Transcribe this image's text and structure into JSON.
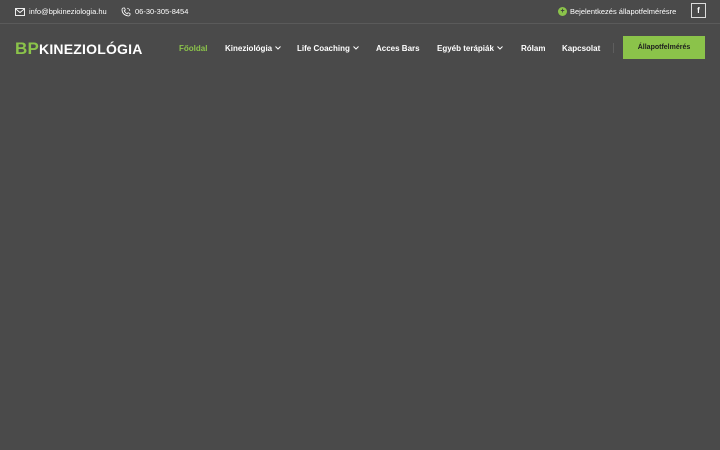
{
  "topbar": {
    "email": "info@bpkineziologia.hu",
    "phone": "06-30-305-8454",
    "booking": "Bejelentkezés állapotfelmérésre",
    "facebook": "f"
  },
  "logo": {
    "prefix": "BP",
    "name": "KINEZIOLÓGIA"
  },
  "nav": {
    "home": "Főoldal",
    "kineziologia": "Kineziológia",
    "life_coaching": "Life Coaching",
    "acces_bars": "Acces Bars",
    "egyeb": "Egyéb terápiák",
    "rolam": "Rólam",
    "kapcsolat": "Kapcsolat"
  },
  "cta": {
    "label": "Állapotfelmérés"
  },
  "colors": {
    "accent": "#8bc34a",
    "background": "#4a4a4a"
  },
  "icons": {
    "email": "envelope-icon",
    "phone": "phone-icon",
    "booking": "plus-circle-icon",
    "facebook": "facebook-icon",
    "dropdown": "chevron-down-icon"
  }
}
